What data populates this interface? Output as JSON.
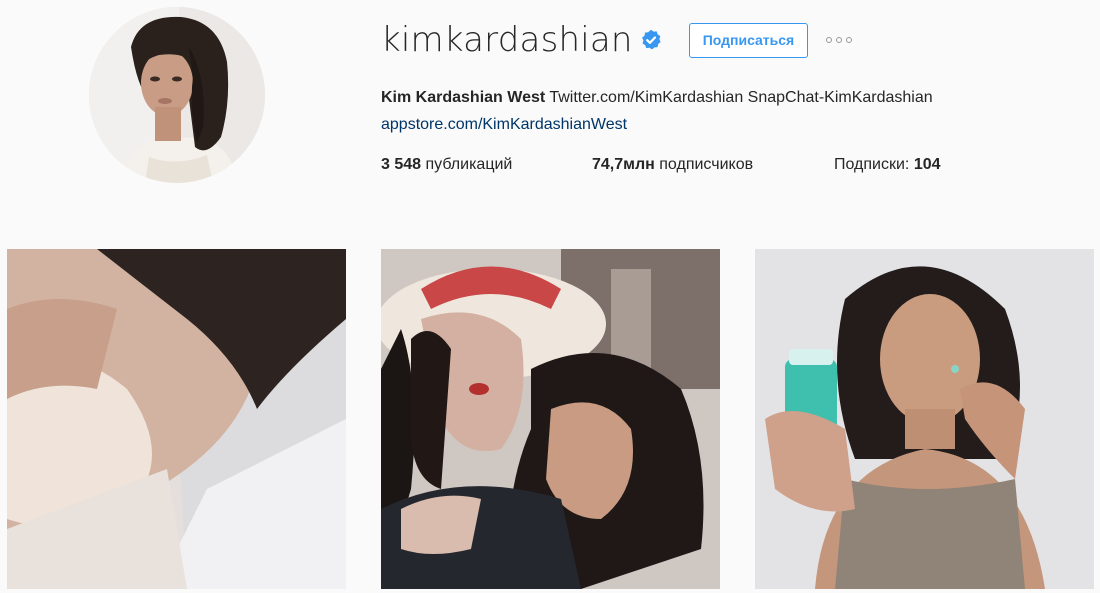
{
  "profile": {
    "username": "kimkardashian",
    "verified": true,
    "follow_label": "Подписаться",
    "bio": {
      "name": "Kim Kardashian West",
      "text": "Twitter.com/KimKardashian SnapChat-KimKardashian",
      "link": "appstore.com/KimKardashianWest"
    },
    "stats": {
      "posts_count": "3 548",
      "posts_label": "публикаций",
      "followers_count": "74,7млн",
      "followers_label": "подписчиков",
      "following_label": "Подписки:",
      "following_count": "104"
    }
  },
  "icons": {
    "verified": "verified-badge-icon",
    "more": "more-options-icon"
  },
  "colors": {
    "accent": "#3897f0",
    "link": "#003569",
    "text": "#262626",
    "background": "#fafafa"
  }
}
